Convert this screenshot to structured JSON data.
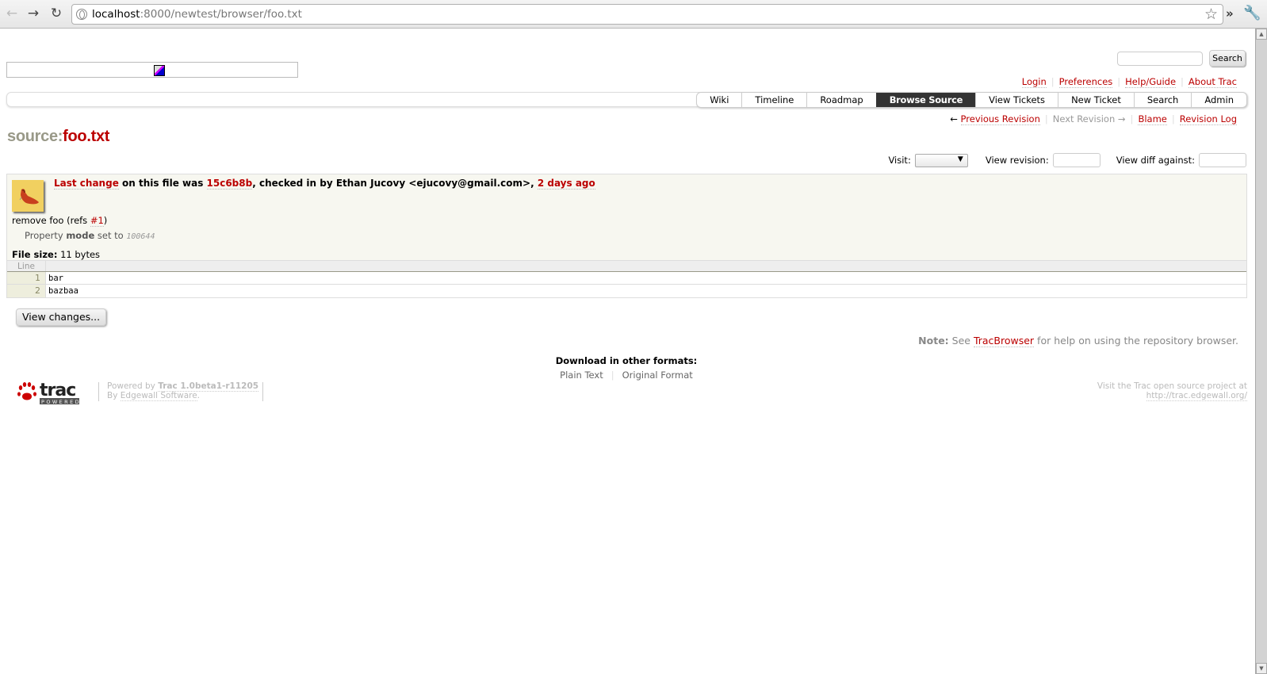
{
  "browser": {
    "url_host": "localhost",
    "url_rest": ":8000/newtest/browser/foo.txt"
  },
  "search": {
    "button_label": "Search",
    "input_value": ""
  },
  "metanav": [
    "Login",
    "Preferences",
    "Help/Guide",
    "About Trac"
  ],
  "mainnav": {
    "tabs": [
      "Wiki",
      "Timeline",
      "Roadmap",
      "Browse Source",
      "View Tickets",
      "New Ticket",
      "Search",
      "Admin"
    ],
    "active": "Browse Source"
  },
  "ctxtnav": {
    "prev_arrow": "←",
    "prev": "Previous Revision",
    "next": "Next Revision",
    "next_arrow": "→",
    "blame": "Blame",
    "log": "Revision Log"
  },
  "title": {
    "prefix": "source:",
    "name": "foo.txt"
  },
  "jump": {
    "visit_label": "Visit:",
    "visit_value": "",
    "rev_label": "View revision:",
    "rev_value": "",
    "diff_label": "View diff against:",
    "diff_value": ""
  },
  "info": {
    "last_change_link": "Last change",
    "text1": " on this file was ",
    "revision": "15c6b8b",
    "text2": ", checked in by Ethan Jucovy <ejucovy@gmail.com>, ",
    "age": "2 days ago",
    "message_prefix": "remove foo (refs ",
    "ticket_ref": "#1",
    "message_suffix": ")",
    "prop_prefix": "Property ",
    "prop_name": "mode",
    "prop_mid": " set to ",
    "prop_value": "100644",
    "filesize_label": "File size:",
    "filesize_value": " 11 bytes"
  },
  "code": {
    "header": "Line",
    "lines": [
      {
        "num": "1",
        "text": "bar"
      },
      {
        "num": "2",
        "text": "bazbaa"
      }
    ]
  },
  "view_changes_label": "View changes...",
  "note": {
    "label": "Note:",
    "text1": " See ",
    "link": "TracBrowser",
    "text2": " for help on using the repository browser."
  },
  "altlinks": {
    "heading": "Download in other formats:",
    "links": [
      "Plain Text",
      "Original Format"
    ]
  },
  "footer": {
    "powered_by": "Powered by ",
    "trac_version": "Trac 1.0beta1-r11205",
    "by": "By ",
    "edgewall": "Edgewall Software",
    "dot": ".",
    "visit_text": "Visit the Trac open source project at",
    "visit_url": "http://trac.edgewall.org/",
    "logo_text": "trac",
    "logo_sub": "POWERED"
  },
  "colors": {
    "link": "#bb0000",
    "active_tab": "#333333",
    "info_bg": "#f7f7f0"
  }
}
